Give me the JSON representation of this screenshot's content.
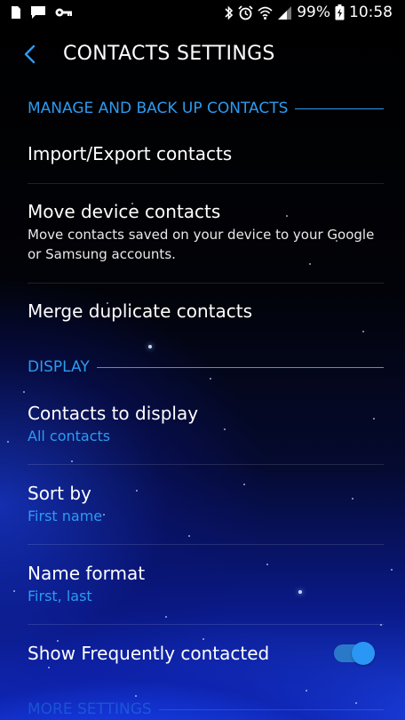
{
  "status_bar": {
    "battery_percent": "99%",
    "time": "10:58",
    "left_icons": [
      "sim-card-icon",
      "message-icon",
      "key-icon"
    ],
    "right_icons": [
      "bluetooth-icon",
      "alarm-icon",
      "wifi-icon",
      "signal-icon",
      "battery-icon"
    ]
  },
  "header": {
    "title": "CONTACTS SETTINGS",
    "back_icon": "chevron-left-icon"
  },
  "sections": {
    "manage": {
      "header": "MANAGE AND BACK UP CONTACTS",
      "items": {
        "import_export": {
          "title": "Import/Export contacts"
        },
        "move_device": {
          "title": "Move device contacts",
          "summary": "Move contacts saved on your device to your Google or Samsung accounts."
        },
        "merge": {
          "title": "Merge duplicate contacts"
        }
      }
    },
    "display": {
      "header": "DISPLAY",
      "items": {
        "contacts_to_display": {
          "title": "Contacts to display",
          "value": "All contacts"
        },
        "sort_by": {
          "title": "Sort by",
          "value": "First name"
        },
        "name_format": {
          "title": "Name format",
          "value": "First, last"
        },
        "show_frequent": {
          "title": "Show Frequently contacted",
          "toggle_on": true
        }
      }
    },
    "more": {
      "header": "MORE SETTINGS"
    }
  },
  "colors": {
    "accent": "#2d9bf0",
    "text": "#ffffff",
    "toggle_track": "#2a79c8",
    "toggle_thumb": "#2a96f5"
  }
}
